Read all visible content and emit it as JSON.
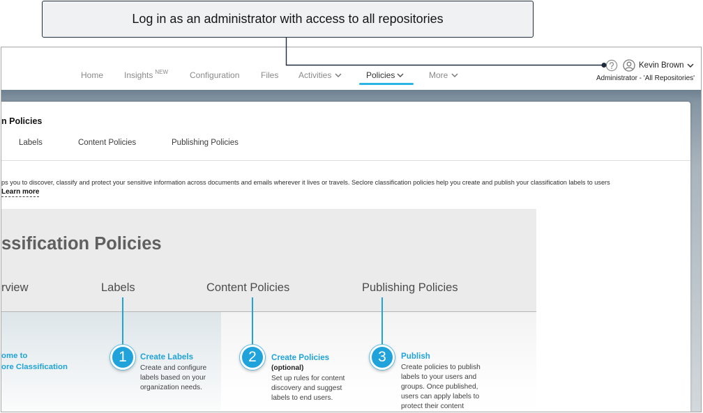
{
  "callout": {
    "text": "Log in as an administrator with access to all repositories"
  },
  "colors": {
    "accent": "#1fa3da",
    "active_underline": "#2ab5e2",
    "connector": "#1e2d3e",
    "nav_text": "#8a8a8a"
  },
  "nav": {
    "items": [
      {
        "label": "Home"
      },
      {
        "label": "Insights",
        "badge": "NEW"
      },
      {
        "label": "Configuration"
      },
      {
        "label": "Files"
      },
      {
        "label": "Activities",
        "icon": "chevron-down-icon"
      },
      {
        "label": "Policies",
        "icon": "chevron-down-icon",
        "active": true
      },
      {
        "label": "More",
        "icon": "chevron-down-icon"
      }
    ],
    "help_icon": "help-circle-icon",
    "user": {
      "icon": "user-circle-icon",
      "name": "Kevin Brown",
      "role": "Administrator - 'All Repositories'",
      "menu_icon": "chevron-down-icon"
    }
  },
  "page": {
    "title": "n Policies",
    "tabs": [
      {
        "label": "Labels"
      },
      {
        "label": "Content Policies"
      },
      {
        "label": "Publishing Policies"
      }
    ],
    "description": "ps you to discover, classify and protect your sensitive information across documents and emails wherever it lives or travels. Seclore classification policies help you create and publish your classification labels to users",
    "learn_more": "Learn more"
  },
  "banner": {
    "title": "ssification Policies",
    "nav": [
      {
        "label": "rview"
      },
      {
        "label": "Labels"
      },
      {
        "label": "Content Policies"
      },
      {
        "label": "Publishing Policies"
      }
    ],
    "welcome": [
      "ome to",
      "ore Classification"
    ],
    "steps": [
      {
        "number": "1",
        "title": "Create Labels",
        "lines": [
          "Create and configure",
          "labels based on your",
          "organization needs."
        ]
      },
      {
        "number": "2",
        "title": "Create Policies",
        "subtitle": "(optional)",
        "lines": [
          "Set up rules for content",
          "discovery and suggest",
          "labels to end users."
        ]
      },
      {
        "number": "3",
        "title": "Publish",
        "lines": [
          "Create policies to publish",
          "labels to your users and",
          "groups. Once published,",
          "users can apply labels to",
          "protect their content"
        ]
      }
    ]
  }
}
